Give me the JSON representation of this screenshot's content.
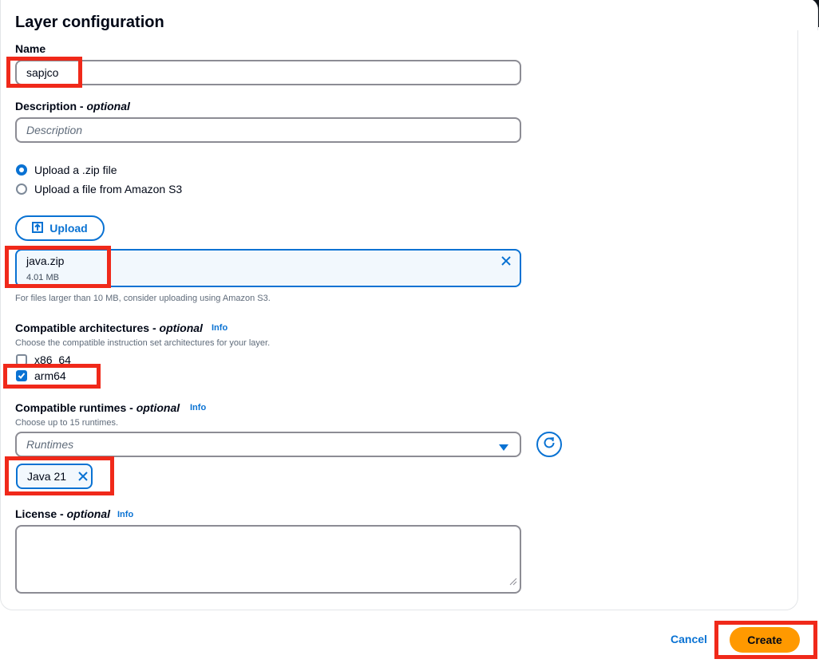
{
  "page": {
    "title": "Layer configuration"
  },
  "name_field": {
    "label": "Name",
    "value": "sapjco"
  },
  "description_field": {
    "label": "Description",
    "optional": "optional",
    "placeholder": "Description"
  },
  "source": {
    "options": [
      {
        "label": "Upload a .zip file",
        "selected": true
      },
      {
        "label": "Upload a file from Amazon S3",
        "selected": false
      }
    ]
  },
  "upload": {
    "button_label": "Upload",
    "file_name": "java.zip",
    "file_size": "4.01 MB",
    "hint": "For files larger than 10 MB, consider uploading using Amazon S3."
  },
  "architectures": {
    "label": "Compatible architectures",
    "optional": "optional",
    "info": "Info",
    "description": "Choose the compatible instruction set architectures for your layer.",
    "options": [
      {
        "label": "x86_64",
        "checked": false
      },
      {
        "label": "arm64",
        "checked": true
      }
    ]
  },
  "runtimes": {
    "label": "Compatible runtimes",
    "optional": "optional",
    "info": "Info",
    "description": "Choose up to 15 runtimes.",
    "placeholder": "Runtimes",
    "selected_token": "Java 21"
  },
  "license": {
    "label": "License",
    "optional": "optional",
    "info": "Info"
  },
  "footer": {
    "cancel_label": "Cancel",
    "create_label": "Create"
  },
  "colors": {
    "accent": "#0972d3",
    "primary_button": "#ff9900",
    "highlight": "#f0291a"
  },
  "icons": {
    "upload": "upload-icon",
    "remove_file": "close-icon",
    "dropdown": "caret-down-icon",
    "refresh": "refresh-icon",
    "remove_token": "close-icon",
    "checkmark": "checkmark-icon"
  }
}
